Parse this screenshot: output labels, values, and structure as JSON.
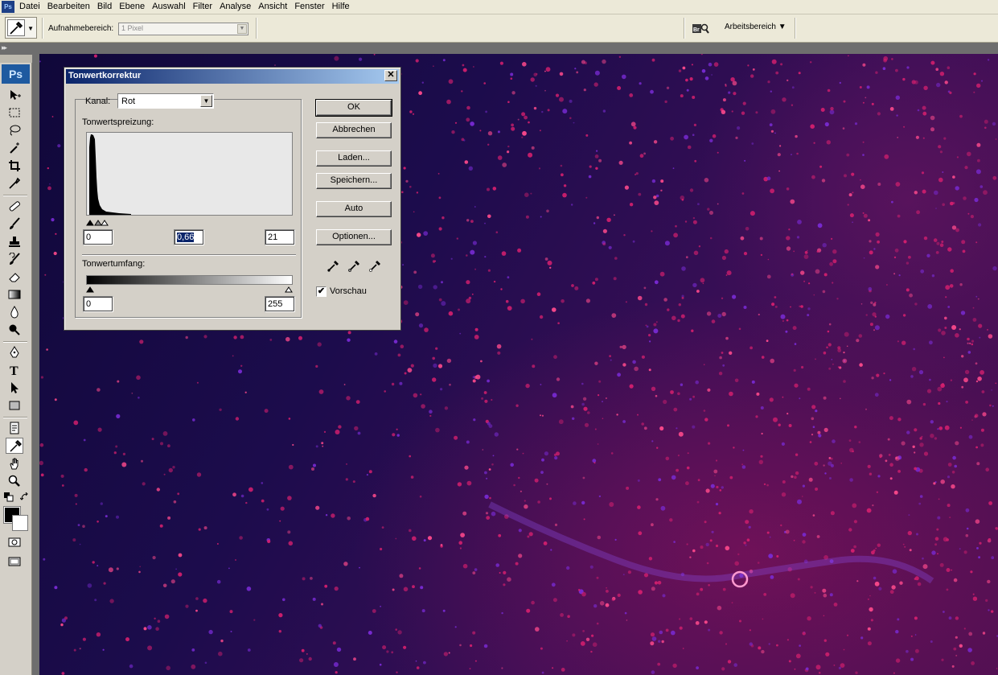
{
  "app": {
    "logo": "Ps"
  },
  "menu": [
    "Datei",
    "Bearbeiten",
    "Bild",
    "Ebene",
    "Auswahl",
    "Filter",
    "Analyse",
    "Ansicht",
    "Fenster",
    "Hilfe"
  ],
  "options_bar": {
    "sample_label": "Aufnahmebereich:",
    "sample_value": "1 Pixel",
    "bridge_label": "Br",
    "workspace_label": "Arbeitsbereich ▼"
  },
  "toolbox": {
    "logo": "Ps",
    "tools": [
      "move",
      "marquee",
      "lasso",
      "magic-wand",
      "crop",
      "slice",
      "healing-brush",
      "brush",
      "clone-stamp",
      "history-brush",
      "eraser",
      "gradient",
      "blur",
      "dodge",
      "pen",
      "type",
      "path-selection",
      "shape",
      "notes",
      "eyedropper",
      "hand",
      "zoom"
    ],
    "selected_tool": "eyedropper",
    "foreground_color": "#000000",
    "background_color": "#ffffff"
  },
  "dialog": {
    "title": "Tonwertkorrektur",
    "channel_label": "Kanal:",
    "channel_value": "Rot",
    "input_levels_label": "Tonwertspreizung:",
    "input_black": "0",
    "input_gamma": "0,66",
    "input_white": "21",
    "output_levels_label": "Tonwertumfang:",
    "output_black": "0",
    "output_white": "255",
    "buttons": {
      "ok": "OK",
      "cancel": "Abbrechen",
      "load": "Laden...",
      "save": "Speichern...",
      "auto": "Auto",
      "options": "Optionen..."
    },
    "preview_label": "Vorschau",
    "preview_checked": true,
    "checkmark": "✔",
    "close_glyph": "✕"
  }
}
